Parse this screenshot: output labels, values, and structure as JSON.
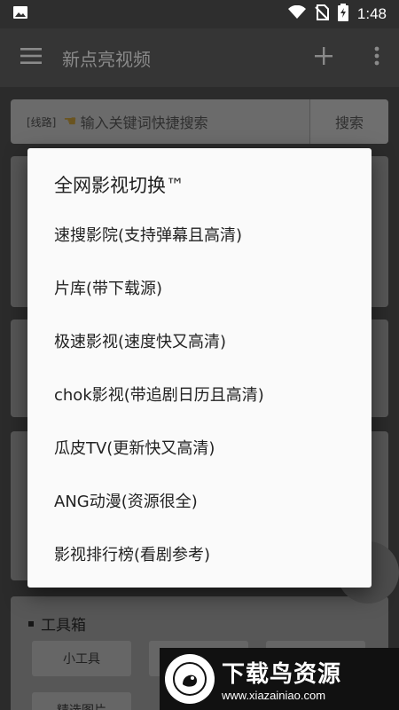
{
  "status_bar": {
    "time": "1:48"
  },
  "app_bar": {
    "title": "新点亮视频"
  },
  "search": {
    "route_label": "[线路]",
    "placeholder": "输入关键词快捷搜索",
    "button_label": "搜索"
  },
  "toolbox": {
    "title": "工具箱",
    "buttons": [
      "小工具",
      "精选图片"
    ]
  },
  "dialog": {
    "title": "全网影视切换™",
    "options": [
      "速搜影院(支持弹幕且高清)",
      "片库(带下载源)",
      "极速影视(速度快又高清)",
      "chok影视(带追剧日历且高清)",
      "瓜皮TV(更新快又高清)",
      "ANG动漫(资源很全)",
      "影视排行榜(看剧参考)"
    ]
  },
  "watermark": {
    "text": "下载鸟资源",
    "url": "www.xiazainiao.com"
  },
  "colors": {
    "dialog_bg": "#fafafa",
    "scrim": "#2b2b2b",
    "status_bar": "#2e2e2e"
  },
  "icons": [
    "image-icon",
    "wifi-icon",
    "no-sim-icon",
    "battery-charging-icon",
    "menu-icon",
    "add-icon",
    "more-vert-icon",
    "hand-pointer-icon"
  ]
}
